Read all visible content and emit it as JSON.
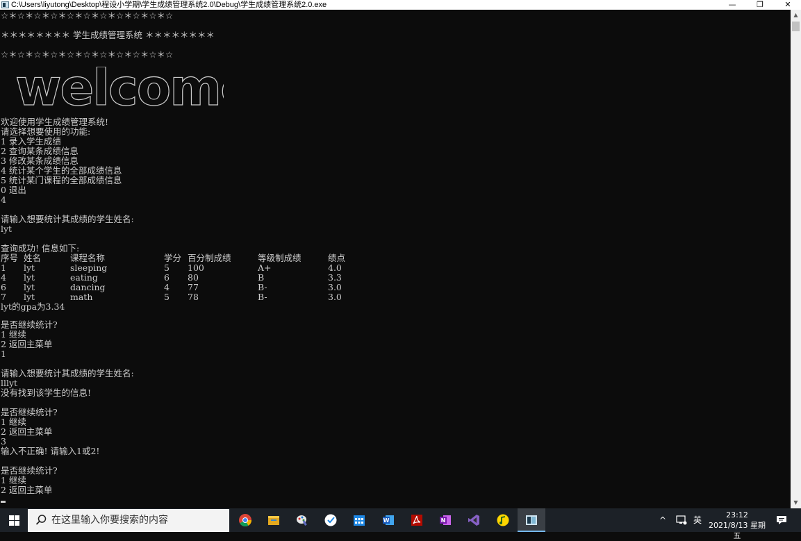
{
  "window": {
    "title": "C:\\Users\\liyutong\\Desktop\\程设小学期\\学生成绩管理系统2.0\\Debug\\学生成绩管理系统2.0.exe",
    "minimize_glyph": "—",
    "maximize_glyph": "❐",
    "close_glyph": "✕"
  },
  "console": {
    "stars_line": "☆＊☆＊☆＊☆＊☆＊☆＊☆＊☆＊☆＊☆＊☆",
    "banner_line": "＊＊＊＊＊＊＊＊ 学生成绩管理系统 ＊＊＊＊＊＊＊＊",
    "welcome_art": "welcome!",
    "intro": "欢迎使用学生成绩管理系统!",
    "prompt_choose": "请选择想要使用的功能:",
    "menu": [
      "1 录入学生成绩",
      "2 查询某条成绩信息",
      "3 修改某条成绩信息",
      "4 统计某个学生的全部成绩信息",
      "5 统计某门课程的全部成绩信息",
      "0 退出"
    ],
    "input_choice": "4",
    "prompt_name_1": "请输入想要统计其成绩的学生姓名:",
    "input_name_1": "lyt",
    "query_success": "查询成功! 信息如下:",
    "table_headers": [
      "序号",
      "姓名",
      "课程名称",
      "学分",
      "百分制成绩",
      "等级制成绩",
      "绩点"
    ],
    "table_rows": [
      [
        "1",
        "lyt",
        "sleeping",
        "5",
        "100",
        "A+",
        "4.0"
      ],
      [
        "4",
        "lyt",
        "eating",
        "6",
        "80",
        "B",
        "3.3"
      ],
      [
        "6",
        "lyt",
        "dancing",
        "4",
        "77",
        "B-",
        "3.0"
      ],
      [
        "7",
        "lyt",
        "math",
        "5",
        "78",
        "B-",
        "3.0"
      ]
    ],
    "gpa_line": "lyt的gpa为3.34",
    "continue_prompt": "是否继续统计?",
    "continue_option": "1 继续",
    "return_option": "2 返回主菜单",
    "input_continue_1": "1",
    "prompt_name_2": "请输入想要统计其成绩的学生姓名:",
    "input_name_2": "lllyt",
    "not_found": "没有找到该学生的信息!",
    "input_continue_2": "3",
    "invalid_input": "输入不正确! 请输入1或2!"
  },
  "taskbar": {
    "search_placeholder": "在这里输入你要搜索的内容",
    "apps": [
      "chrome-icon",
      "file-explorer-icon",
      "paint-icon",
      "tasks-icon",
      "calendar-icon",
      "word-icon",
      "acrobat-icon",
      "onenote-icon",
      "visual-studio-icon",
      "qq-music-icon",
      "console-app-icon"
    ],
    "tray_chevron": "^",
    "ime": "英",
    "time": "23:12",
    "date": "2021/8/13 星期五"
  },
  "colors": {
    "console_bg": "#0c0c0c",
    "console_text": "#cccccc",
    "taskbar_bg": "#1c2127",
    "accent": "#76b9ed"
  }
}
